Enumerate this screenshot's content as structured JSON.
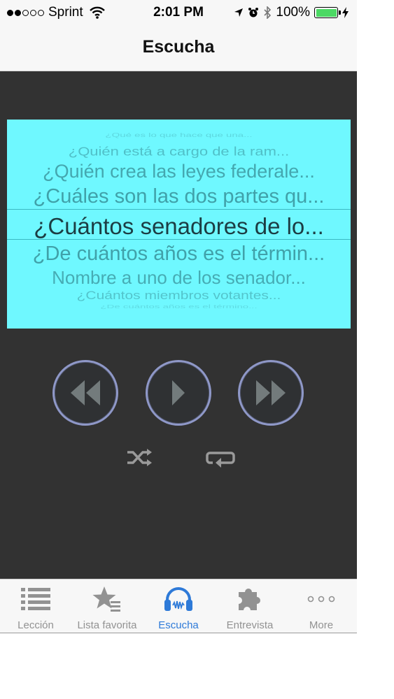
{
  "status_bar": {
    "carrier": "Sprint",
    "time": "2:01 PM",
    "battery": "100%"
  },
  "nav": {
    "title": "Escucha"
  },
  "picker": {
    "rows": [
      "¿Qué es lo que hace que una...",
      "¿Quién está a cargo de la ram...",
      "¿Quién crea las leyes federale...",
      "¿Cuáles son las dos partes qu...",
      "¿Cuántos senadores de lo...",
      "¿De cuántos años es el términ...",
      "Nombre a uno de los senador...",
      "¿Cuántos miembros votantes...",
      "¿De cuántos años es el término..."
    ]
  },
  "controls": {
    "rewind": "rewind-icon",
    "play": "play-icon",
    "forward": "fast-forward-icon",
    "shuffle": "shuffle-icon",
    "repeat": "repeat-icon"
  },
  "tabs": [
    {
      "label": "Lección",
      "icon": "list-icon",
      "active": false
    },
    {
      "label": "Lista favorita",
      "icon": "star-list-icon",
      "active": false
    },
    {
      "label": "Escucha",
      "icon": "headphones-icon",
      "active": true
    },
    {
      "label": "Entrevista",
      "icon": "puzzle-icon",
      "active": false
    },
    {
      "label": "More",
      "icon": "more-icon",
      "active": false
    }
  ],
  "colors": {
    "picker_bg": "#6ff8ff",
    "content_bg": "#323232",
    "active_tab": "#2e7ad8",
    "inactive_tab": "#929292",
    "battery": "#4cd964"
  }
}
